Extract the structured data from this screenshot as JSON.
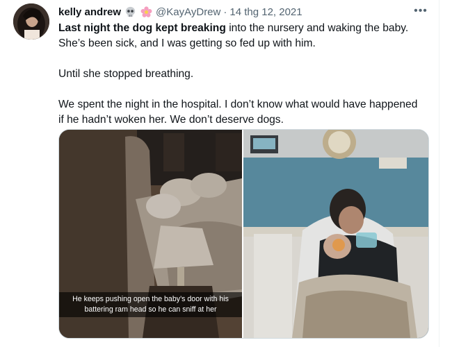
{
  "tweet": {
    "display_name": "kelly andrew",
    "name_emojis": [
      "skull-emoji",
      "flower-emoji"
    ],
    "handle": "@KayAyDrew",
    "separator": "·",
    "timestamp": "14 thg 12, 2021",
    "more_icon": "more-horizontal-icon",
    "more_label": "•••",
    "text": {
      "bold_lead": "Last night the dog kept breaking",
      "line1_rest": " into the nursery and waking the baby.",
      "line2": "She’s been sick, and I was getting so fed up with him.",
      "para2": "Until she stopped breathing.",
      "para3_line1": "We spent the night in the hospital. I don’t know what would have happened",
      "para3_line2": "if he hadn’t woken her. We don’t deserve dogs."
    },
    "media": {
      "left_caption_line1": "He keeps pushing open the baby’s door with his",
      "left_caption_line2": "battering ram head so he can sniff at her"
    }
  },
  "colors": {
    "text_primary": "#0f1419",
    "text_secondary": "#536471",
    "border": "#cfd9de"
  }
}
